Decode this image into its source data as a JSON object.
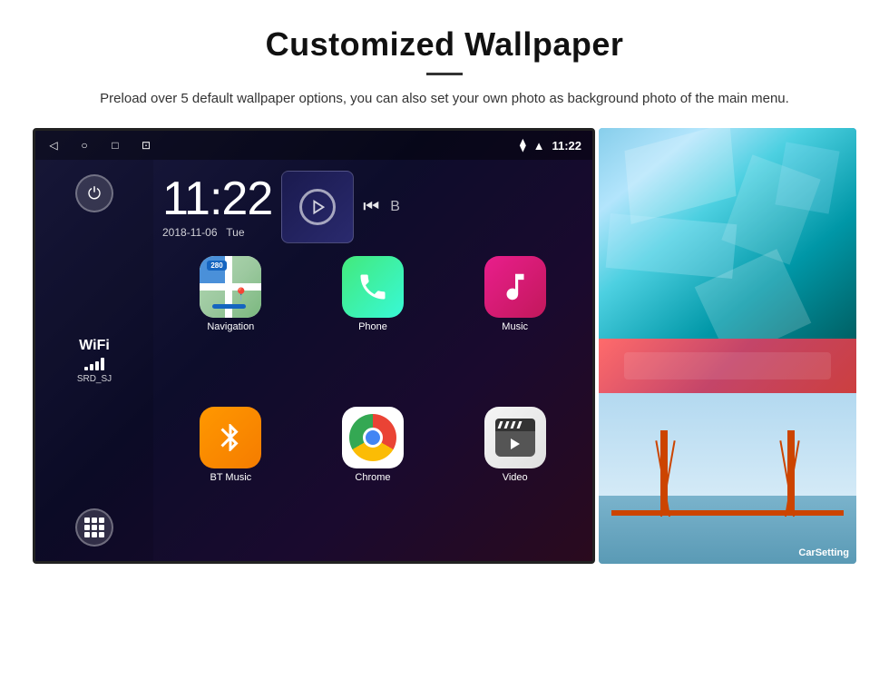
{
  "header": {
    "title": "Customized Wallpaper",
    "description": "Preload over 5 default wallpaper options, you can also set your own photo as background photo of the main menu."
  },
  "device": {
    "status_bar": {
      "time": "11:22",
      "wifi_icon": "📶",
      "location_icon": "📍"
    },
    "clock": {
      "time": "11:22",
      "date": "2018-11-06",
      "day": "Tue"
    },
    "wifi": {
      "label": "WiFi",
      "ssid": "SRD_SJ"
    },
    "apps": [
      {
        "name": "Navigation",
        "label": "Navigation",
        "type": "navigation"
      },
      {
        "name": "Phone",
        "label": "Phone",
        "type": "phone"
      },
      {
        "name": "Music",
        "label": "Music",
        "type": "music"
      },
      {
        "name": "BT Music",
        "label": "BT Music",
        "type": "bt"
      },
      {
        "name": "Chrome",
        "label": "Chrome",
        "type": "chrome"
      },
      {
        "name": "Video",
        "label": "Video",
        "type": "video"
      }
    ],
    "nav_badge": "280"
  },
  "wallpapers": {
    "carsetting_label": "CarSetting"
  }
}
